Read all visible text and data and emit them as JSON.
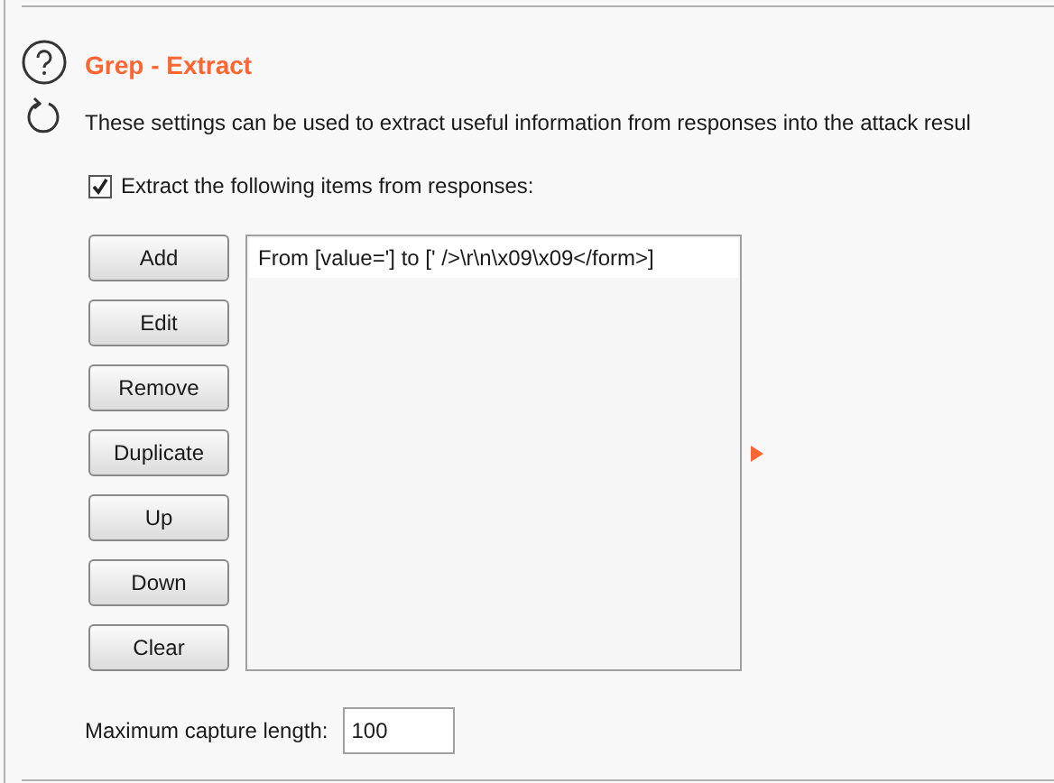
{
  "section": {
    "title": "Grep - Extract",
    "description": "These settings can be used to extract useful information from responses into the attack resul"
  },
  "extract_option": {
    "label": "Extract the following items from responses:",
    "checked": true
  },
  "buttons": [
    "Add",
    "Edit",
    "Remove",
    "Duplicate",
    "Up",
    "Down",
    "Clear"
  ],
  "items": [
    "From [value='] to [' />\\r\\n\\x09\\x09</form>]"
  ],
  "max_capture_length": {
    "label": "Maximum capture length:",
    "value": "100"
  }
}
